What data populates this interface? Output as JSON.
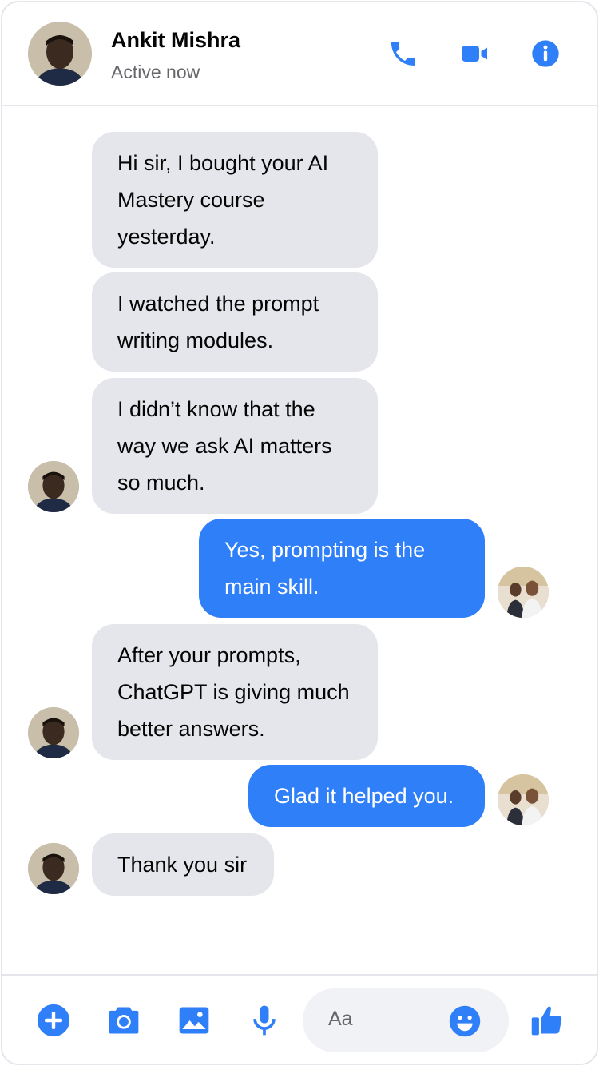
{
  "header": {
    "name": "Ankit Mishra",
    "status": "Active now",
    "icons": [
      "phone-icon",
      "video-camera-icon",
      "info-icon"
    ]
  },
  "accent_color": "#2e7ff8",
  "messages": [
    {
      "from": "contact",
      "text": "Hi sir, I bought your AI Mastery course yesterday."
    },
    {
      "from": "contact",
      "text": "I watched the prompt writing modules."
    },
    {
      "from": "contact",
      "text": "I didn’t know that the way we ask AI matters so much."
    },
    {
      "from": "me",
      "text": "Yes, prompting is the main skill."
    },
    {
      "from": "contact",
      "text": "After your prompts, ChatGPT is giving much better answers."
    },
    {
      "from": "me",
      "text": "Glad it helped you."
    },
    {
      "from": "contact",
      "text": "Thank you sir"
    }
  ],
  "composer": {
    "placeholder": "Aa",
    "icons": [
      "plus-icon",
      "camera-icon",
      "image-icon",
      "microphone-icon",
      "emoji-icon",
      "thumbs-up-icon"
    ]
  }
}
